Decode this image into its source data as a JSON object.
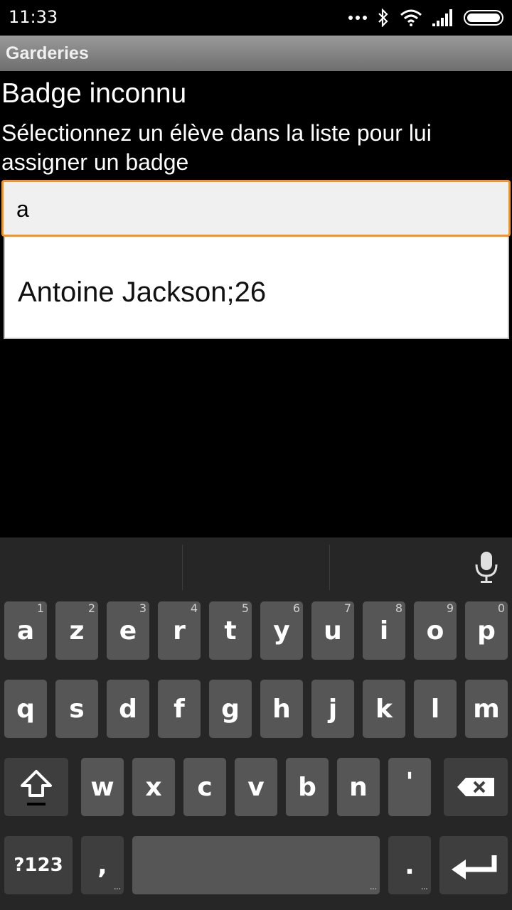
{
  "status": {
    "time": "11:33"
  },
  "app": {
    "title": "Garderies"
  },
  "screen": {
    "heading": "Badge inconnu",
    "instructions": "Sélectionnez un élève dans la liste pour lui assigner un badge"
  },
  "search": {
    "value": "a"
  },
  "suggestions": [
    "Antoine Jackson;26"
  ],
  "keyboard": {
    "row1": [
      {
        "label": "a",
        "hint": "1"
      },
      {
        "label": "z",
        "hint": "2"
      },
      {
        "label": "e",
        "hint": "3"
      },
      {
        "label": "r",
        "hint": "4"
      },
      {
        "label": "t",
        "hint": "5"
      },
      {
        "label": "y",
        "hint": "6"
      },
      {
        "label": "u",
        "hint": "7"
      },
      {
        "label": "i",
        "hint": "8"
      },
      {
        "label": "o",
        "hint": "9"
      },
      {
        "label": "p",
        "hint": "0"
      }
    ],
    "row2": [
      "q",
      "s",
      "d",
      "f",
      "g",
      "h",
      "j",
      "k",
      "l",
      "m"
    ],
    "row3": [
      "w",
      "x",
      "c",
      "v",
      "b",
      "n",
      "'"
    ],
    "symbols": "?123",
    "comma": ",",
    "period": ".",
    "key_more": "..."
  },
  "colors": {
    "accent": "#f7931e",
    "keyboard_bg": "#262626",
    "key_bg": "#565656"
  },
  "icons": [
    "bluetooth-icon",
    "wifi-icon",
    "signal-icon",
    "battery-icon",
    "mic-icon",
    "shift-icon",
    "backspace-icon",
    "enter-icon"
  ]
}
